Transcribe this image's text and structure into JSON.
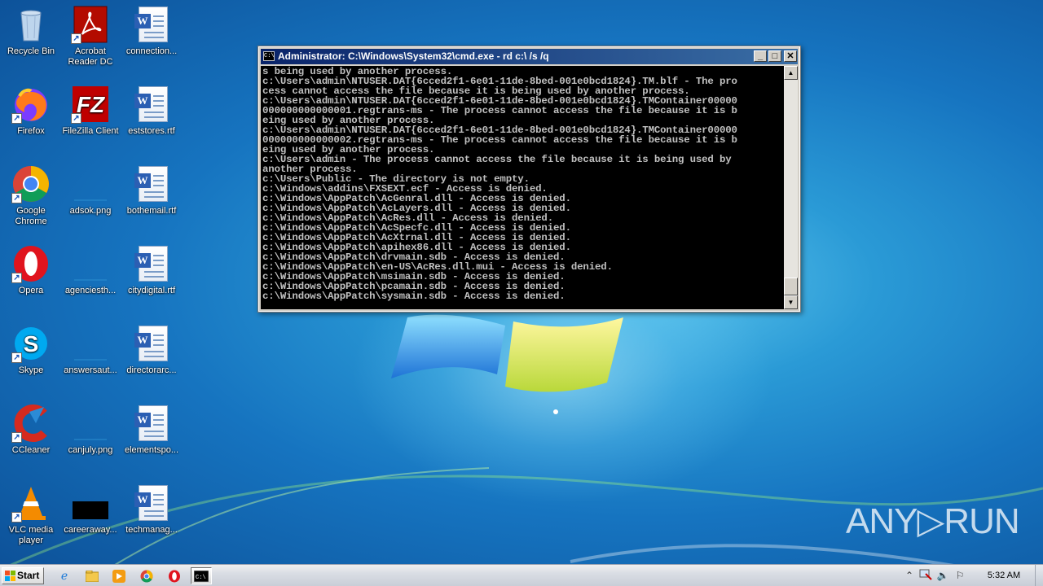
{
  "desktop": {
    "icons_col1": [
      {
        "label": "Recycle Bin",
        "icon": "recycle-bin-icon",
        "shortcut": false
      },
      {
        "label": "Acrobat Reader DC",
        "icon": "acrobat-icon",
        "shortcut": true
      },
      {
        "label": "Firefox",
        "icon": "firefox-icon",
        "shortcut": true
      },
      {
        "label": "FileZilla Client",
        "icon": "filezilla-icon",
        "shortcut": true
      },
      {
        "label": "Google Chrome",
        "icon": "chrome-icon",
        "shortcut": true
      },
      {
        "label": "Opera",
        "icon": "opera-icon",
        "shortcut": true
      },
      {
        "label": "Skype",
        "icon": "skype-icon",
        "shortcut": true
      },
      {
        "label": "CCleaner",
        "icon": "ccleaner-icon",
        "shortcut": true
      },
      {
        "label": "VLC media player",
        "icon": "vlc-icon",
        "shortcut": true
      }
    ],
    "icons_col2": [
      {
        "label": "adsok.png",
        "icon": "image-file-icon"
      },
      {
        "label": "agenciesth...",
        "icon": "image-file-icon"
      },
      {
        "label": "answersaut...",
        "icon": "image-file-icon"
      },
      {
        "label": "canjuly.png",
        "icon": "image-file-icon"
      },
      {
        "label": "careeraway...",
        "icon": "image-file-icon"
      }
    ],
    "icons_col3": [
      {
        "label": "connection...",
        "icon": "word-doc-icon"
      },
      {
        "label": "eststores.rtf",
        "icon": "word-doc-icon"
      },
      {
        "label": "bothemail.rtf",
        "icon": "word-doc-icon"
      },
      {
        "label": "citydigital.rtf",
        "icon": "word-doc-icon"
      },
      {
        "label": "directorarc...",
        "icon": "word-doc-icon"
      },
      {
        "label": "elementspo...",
        "icon": "word-doc-icon"
      },
      {
        "label": "techmanag...",
        "icon": "word-doc-icon"
      }
    ]
  },
  "cmd_window": {
    "title": "Administrator: C:\\Windows\\System32\\cmd.exe - rd  c:\\ /s /q",
    "icon_text": "C:\\",
    "buttons": {
      "minimize": "_",
      "maximize": "□",
      "close": "✕"
    },
    "lines": [
      "s being used by another process.",
      "c:\\Users\\admin\\NTUSER.DAT{6cced2f1-6e01-11de-8bed-001e0bcd1824}.TM.blf - The pro",
      "cess cannot access the file because it is being used by another process.",
      "c:\\Users\\admin\\NTUSER.DAT{6cced2f1-6e01-11de-8bed-001e0bcd1824}.TMContainer00000",
      "000000000000001.regtrans-ms - The process cannot access the file because it is b",
      "eing used by another process.",
      "c:\\Users\\admin\\NTUSER.DAT{6cced2f1-6e01-11de-8bed-001e0bcd1824}.TMContainer00000",
      "000000000000002.regtrans-ms - The process cannot access the file because it is b",
      "eing used by another process.",
      "c:\\Users\\admin - The process cannot access the file because it is being used by",
      "another process.",
      "c:\\Users\\Public - The directory is not empty.",
      "c:\\Windows\\addins\\FXSEXT.ecf - Access is denied.",
      "c:\\Windows\\AppPatch\\AcGenral.dll - Access is denied.",
      "c:\\Windows\\AppPatch\\AcLayers.dll - Access is denied.",
      "c:\\Windows\\AppPatch\\AcRes.dll - Access is denied.",
      "c:\\Windows\\AppPatch\\AcSpecfc.dll - Access is denied.",
      "c:\\Windows\\AppPatch\\AcXtrnal.dll - Access is denied.",
      "c:\\Windows\\AppPatch\\apihex86.dll - Access is denied.",
      "c:\\Windows\\AppPatch\\drvmain.sdb - Access is denied.",
      "c:\\Windows\\AppPatch\\en-US\\AcRes.dll.mui - Access is denied.",
      "c:\\Windows\\AppPatch\\msimain.sdb - Access is denied.",
      "c:\\Windows\\AppPatch\\pcamain.sdb - Access is denied.",
      "c:\\Windows\\AppPatch\\sysmain.sdb - Access is denied."
    ]
  },
  "watermark": {
    "text": "ANY▷RUN"
  },
  "taskbar": {
    "start_label": "Start",
    "pinned": [
      "ie-icon",
      "explorer-icon",
      "media-player-icon",
      "chrome-icon",
      "opera-icon",
      "cmd-icon"
    ],
    "clock": "5:32 AM"
  }
}
